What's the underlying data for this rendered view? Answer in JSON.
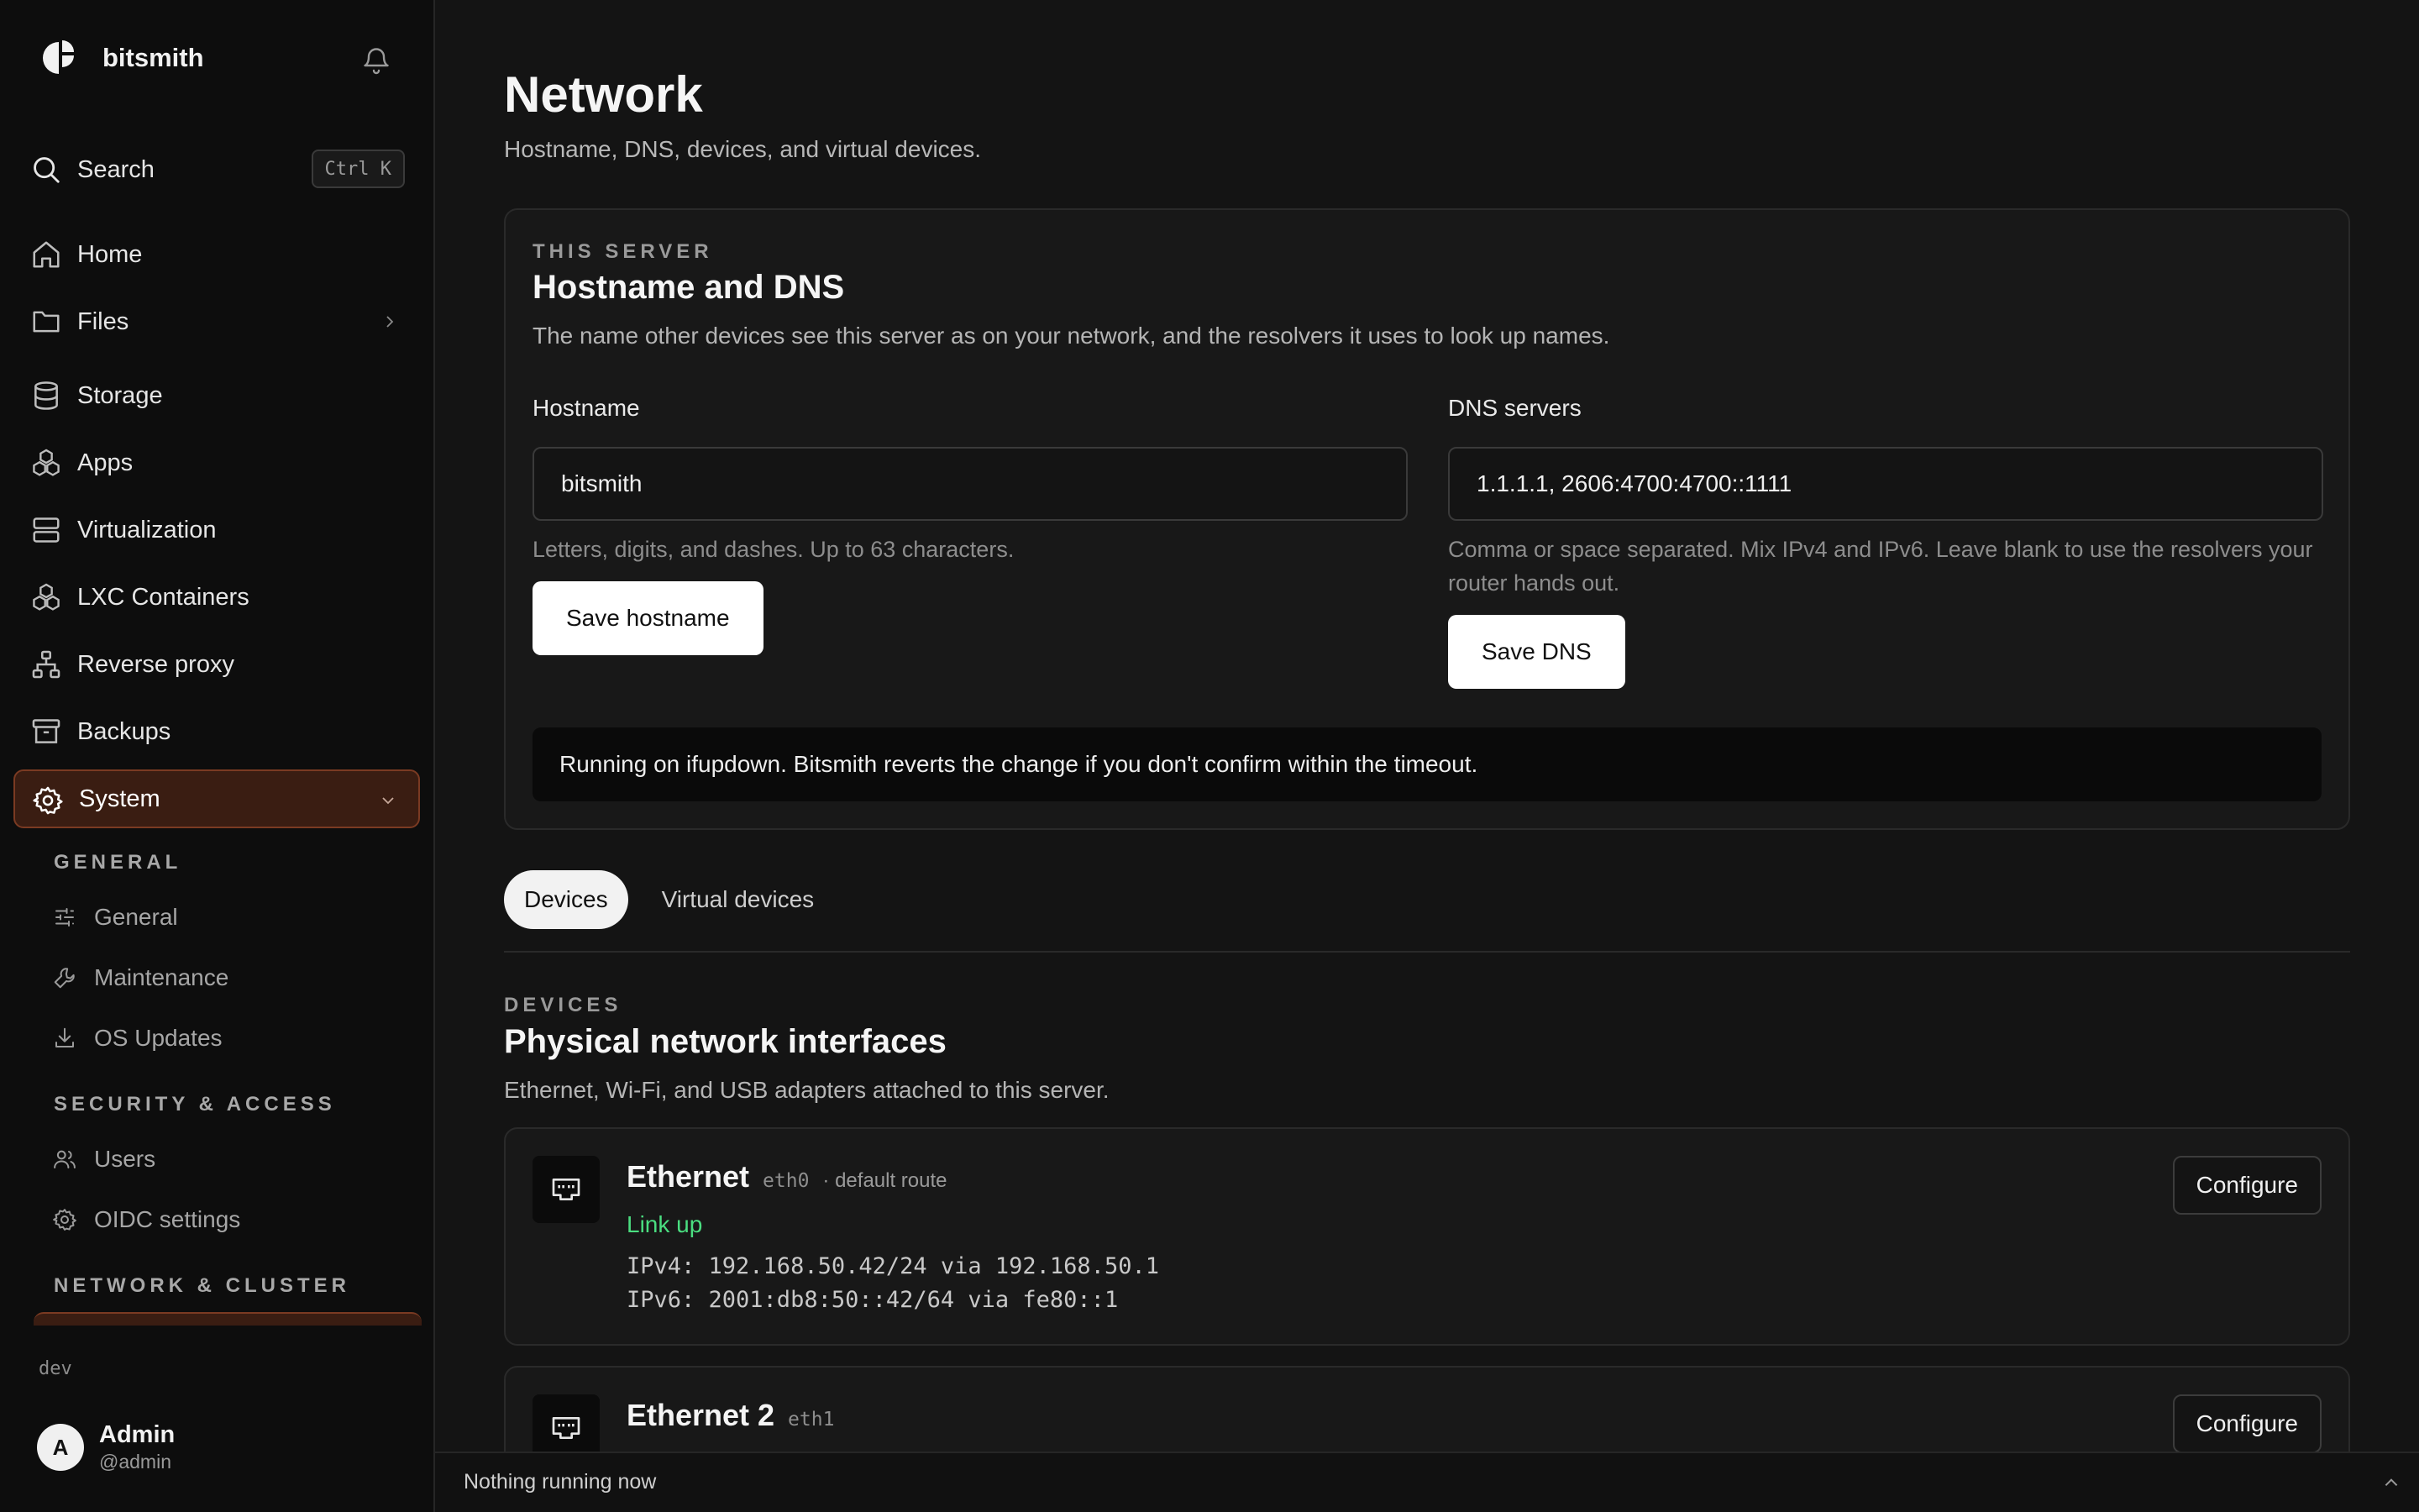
{
  "app": {
    "name": "bitsmith",
    "env": "dev"
  },
  "sidebar": {
    "search": {
      "label": "Search",
      "shortcut": "Ctrl K"
    },
    "items": [
      {
        "label": "Home",
        "icon": "home-icon"
      },
      {
        "label": "Files",
        "icon": "folder-icon"
      },
      {
        "label": "Storage",
        "icon": "database-icon"
      },
      {
        "label": "Apps",
        "icon": "apps-icon"
      },
      {
        "label": "Virtualization",
        "icon": "server-icon"
      },
      {
        "label": "LXC Containers",
        "icon": "containers-icon"
      },
      {
        "label": "Reverse proxy",
        "icon": "network-icon"
      },
      {
        "label": "Backups",
        "icon": "archive-icon"
      },
      {
        "label": "System",
        "icon": "gear-icon",
        "active": true
      }
    ],
    "groups": [
      {
        "title": "GENERAL",
        "items": [
          {
            "label": "General",
            "icon": "sliders-icon"
          },
          {
            "label": "Maintenance",
            "icon": "wrench-icon"
          },
          {
            "label": "OS Updates",
            "icon": "download-icon"
          }
        ]
      },
      {
        "title": "SECURITY & ACCESS",
        "items": [
          {
            "label": "Users",
            "icon": "users-icon"
          },
          {
            "label": "OIDC settings",
            "icon": "gear-icon"
          }
        ]
      },
      {
        "title": "NETWORK & CLUSTER",
        "items": []
      }
    ],
    "user": {
      "initial": "A",
      "name": "Admin",
      "handle": "@admin"
    }
  },
  "page": {
    "title": "Network",
    "subtitle": "Hostname, DNS, devices, and virtual devices."
  },
  "hostname_card": {
    "eyebrow": "THIS SERVER",
    "title": "Hostname and DNS",
    "description": "The name other devices see this server as on your network, and the resolvers it uses to look up names.",
    "hostname": {
      "label": "Hostname",
      "value": "bitsmith",
      "hint": "Letters, digits, and dashes. Up to 63 characters.",
      "button": "Save hostname"
    },
    "dns": {
      "label": "DNS servers",
      "value": "1.1.1.1, 2606:4700:4700::1111",
      "hint": "Comma or space separated. Mix IPv4 and IPv6. Leave blank to use the resolvers your router hands out.",
      "button": "Save DNS"
    },
    "notice": "Running on ifupdown. Bitsmith reverts the change if you don't confirm within the timeout."
  },
  "tabs": [
    {
      "label": "Devices",
      "active": true
    },
    {
      "label": "Virtual devices",
      "active": false
    }
  ],
  "devices_section": {
    "eyebrow": "DEVICES",
    "title": "Physical network interfaces",
    "description": "Ethernet, Wi-Fi, and USB adapters attached to this server.",
    "devices": [
      {
        "name": "Ethernet",
        "iface": "eth0",
        "route": "· default route",
        "status": "Link up",
        "ipv4": "IPv4: 192.168.50.42/24 via 192.168.50.1",
        "ipv6": "IPv6: 2001:db8:50::42/64 via fe80::1",
        "button": "Configure"
      },
      {
        "name": "Ethernet 2",
        "iface": "eth1",
        "button": "Configure"
      }
    ]
  },
  "statusbar": {
    "text": "Nothing running now"
  },
  "colors": {
    "accent_bg": "#3a1d12",
    "accent_border": "#7a3a22",
    "link_up": "#4ade80"
  }
}
